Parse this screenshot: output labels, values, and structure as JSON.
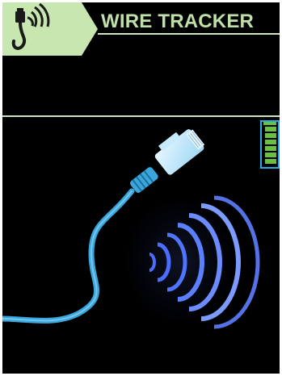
{
  "app": {
    "title": "WIRE TRACKER",
    "logo_icon": "ethernet-signal-icon"
  },
  "status": {
    "battery_icon": "battery-icon",
    "battery_level": 1.0
  },
  "illustration": {
    "icon": "ethernet-cable-signal-illustration"
  },
  "colors": {
    "accent_green": "#c7e6b0",
    "title_green": "#bfe0a8",
    "divider": "#cfe5c2",
    "battery_outline": "#29abe2",
    "battery_fill": "#6abf45",
    "cable_blue": "#3aa6dc",
    "signal_blue": "#4a6cff",
    "background": "#000000"
  }
}
